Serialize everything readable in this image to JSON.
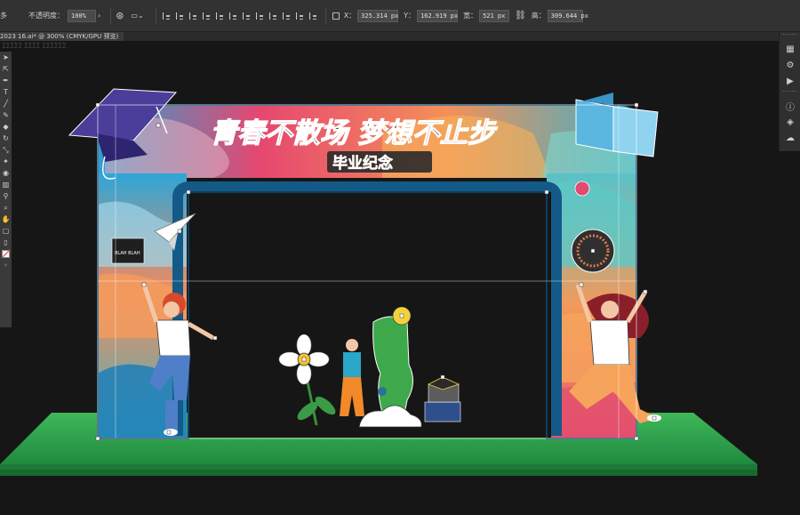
{
  "control_bar": {
    "cut_label": "多",
    "opacity_label": "不透明度：",
    "opacity_value": "100%",
    "x_label": "X：",
    "x_value": "325.314 px",
    "y_label": "Y：",
    "y_value": "162.919 px",
    "width_label": "宽：",
    "width_value": "521 px",
    "height_label": "高：",
    "height_value": "309.644 px"
  },
  "document": {
    "tab_title": "2023 16.ai* @ 300% (CMYK/GPU 预览)",
    "path_text": "ΣΣΣΣΣ ΣΣΣΣ ΣΣΣΣΣΣ"
  },
  "artwork": {
    "title": "青春不散场  梦想不止步",
    "subtitle": "毕业纪念",
    "sign_text": "BLAH BLAH"
  },
  "colors": {
    "chrome_dark": "#323232",
    "canvas": "#161616",
    "arch_blue": "#2f6fa0",
    "arch_orange": "#f28e5a",
    "arch_pink": "#e24a6f",
    "grass": "#2fa44f",
    "selection_white": "#ffffff"
  },
  "icons": {
    "tools": [
      "selection-icon",
      "direct-selection-icon",
      "pen-icon",
      "type-icon",
      "line-icon",
      "brush-icon",
      "eraser-icon",
      "rotate-icon",
      "scale-icon",
      "warp-icon",
      "shape-builder-icon",
      "graph-icon",
      "eyedropper-icon",
      "zoom-icon",
      "hand-icon",
      "artboard-icon"
    ],
    "dock": [
      "libraries-icon",
      "properties-icon",
      "actions-icon",
      "info-icon",
      "layers-icon",
      "creative-cloud-icon"
    ]
  }
}
